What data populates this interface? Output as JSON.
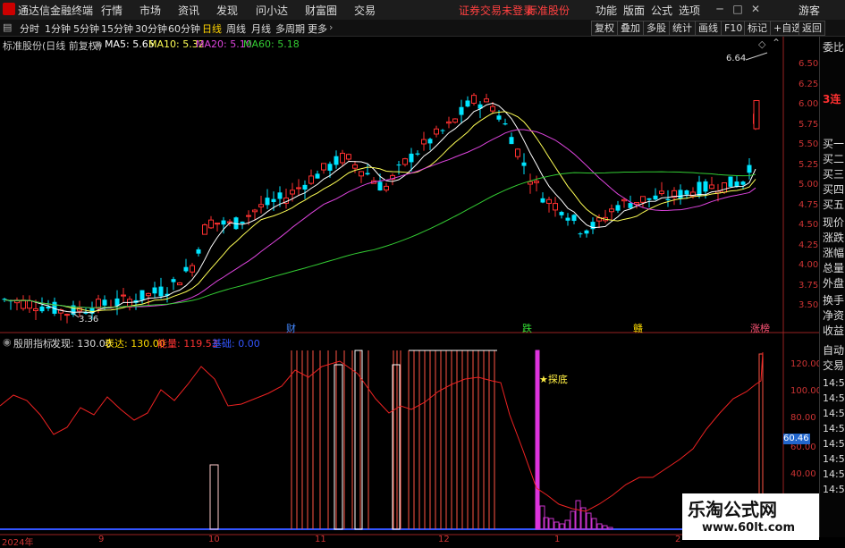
{
  "titlebar": {
    "app_title": "通达信金融终端",
    "menus": [
      "行情",
      "市场",
      "资讯",
      "发现",
      "问小达",
      "财富圈",
      "交易"
    ],
    "alert": "证券交易未登录",
    "stock": "标准股份",
    "right_menus": [
      "功能",
      "版面",
      "公式",
      "选项"
    ],
    "guest": "游客"
  },
  "toolbar": {
    "periods": [
      "分时",
      "1分钟",
      "5分钟",
      "15分钟",
      "30分钟",
      "60分钟",
      "日线",
      "周线",
      "月线",
      "多周期",
      "更多"
    ],
    "active_period": "日线",
    "right_buttons": [
      "复权",
      "叠加",
      "多股",
      "统计",
      "画线",
      "F10",
      "标记",
      "+自选",
      "返回"
    ]
  },
  "chart_header": {
    "stock_label": "标准股份(日线 前复权)",
    "ma5": "MA5: 5.65",
    "ma10": "MA10: 5.32",
    "ma20": "MA20: 5.10",
    "ma60": "MA60: 5.18"
  },
  "indicator_header": {
    "name": "殷朋指标",
    "faxian": "发现: 130.00",
    "biaoda": "表达: 130.00",
    "nengliang": "能量: 119.53",
    "jiyu": "基础: 0.00"
  },
  "annotations": {
    "high": "6.64",
    "low": "3.36",
    "event_cai": "财",
    "event_die": "跌",
    "event_fu": "赣",
    "event_zhang": "涨榜",
    "tandi": "★探底",
    "current_value": "60.46"
  },
  "price_ticks": [
    "6.50",
    "6.25",
    "6.00",
    "5.75",
    "5.50",
    "5.25",
    "5.00",
    "4.75",
    "4.50",
    "4.25",
    "4.00",
    "3.75",
    "3.50"
  ],
  "ind_ticks": [
    "120.00",
    "100.00",
    "80.00",
    "60.00",
    "40.00"
  ],
  "x_labels": [
    "2024年",
    "9",
    "10",
    "11",
    "12",
    "1",
    "2"
  ],
  "side_panel": {
    "items": [
      "委比",
      "3连",
      "买一",
      "买二",
      "买三",
      "买四",
      "买五",
      "现价",
      "涨跌",
      "涨幅",
      "总量",
      "外盘",
      "换手",
      "净资",
      "收益",
      "自动",
      "交易",
      "14:55",
      "14:55",
      "14:55",
      "14:55",
      "14:55",
      "14:55",
      "14:55",
      "14:55"
    ]
  },
  "watermark": {
    "line1": "乐淘公式网",
    "line2": "www.60lt.com"
  },
  "colors": {
    "up": "#ff3030",
    "down": "#00e5ff",
    "ma5": "#ffffff",
    "ma10": "#ffff55",
    "ma20": "#dd44dd",
    "ma60": "#33cc33"
  },
  "chart_data": {
    "type": "candlestick",
    "ylim": [
      3.3,
      6.7
    ],
    "ma_series": [
      "MA5",
      "MA10",
      "MA20",
      "MA60"
    ]
  }
}
